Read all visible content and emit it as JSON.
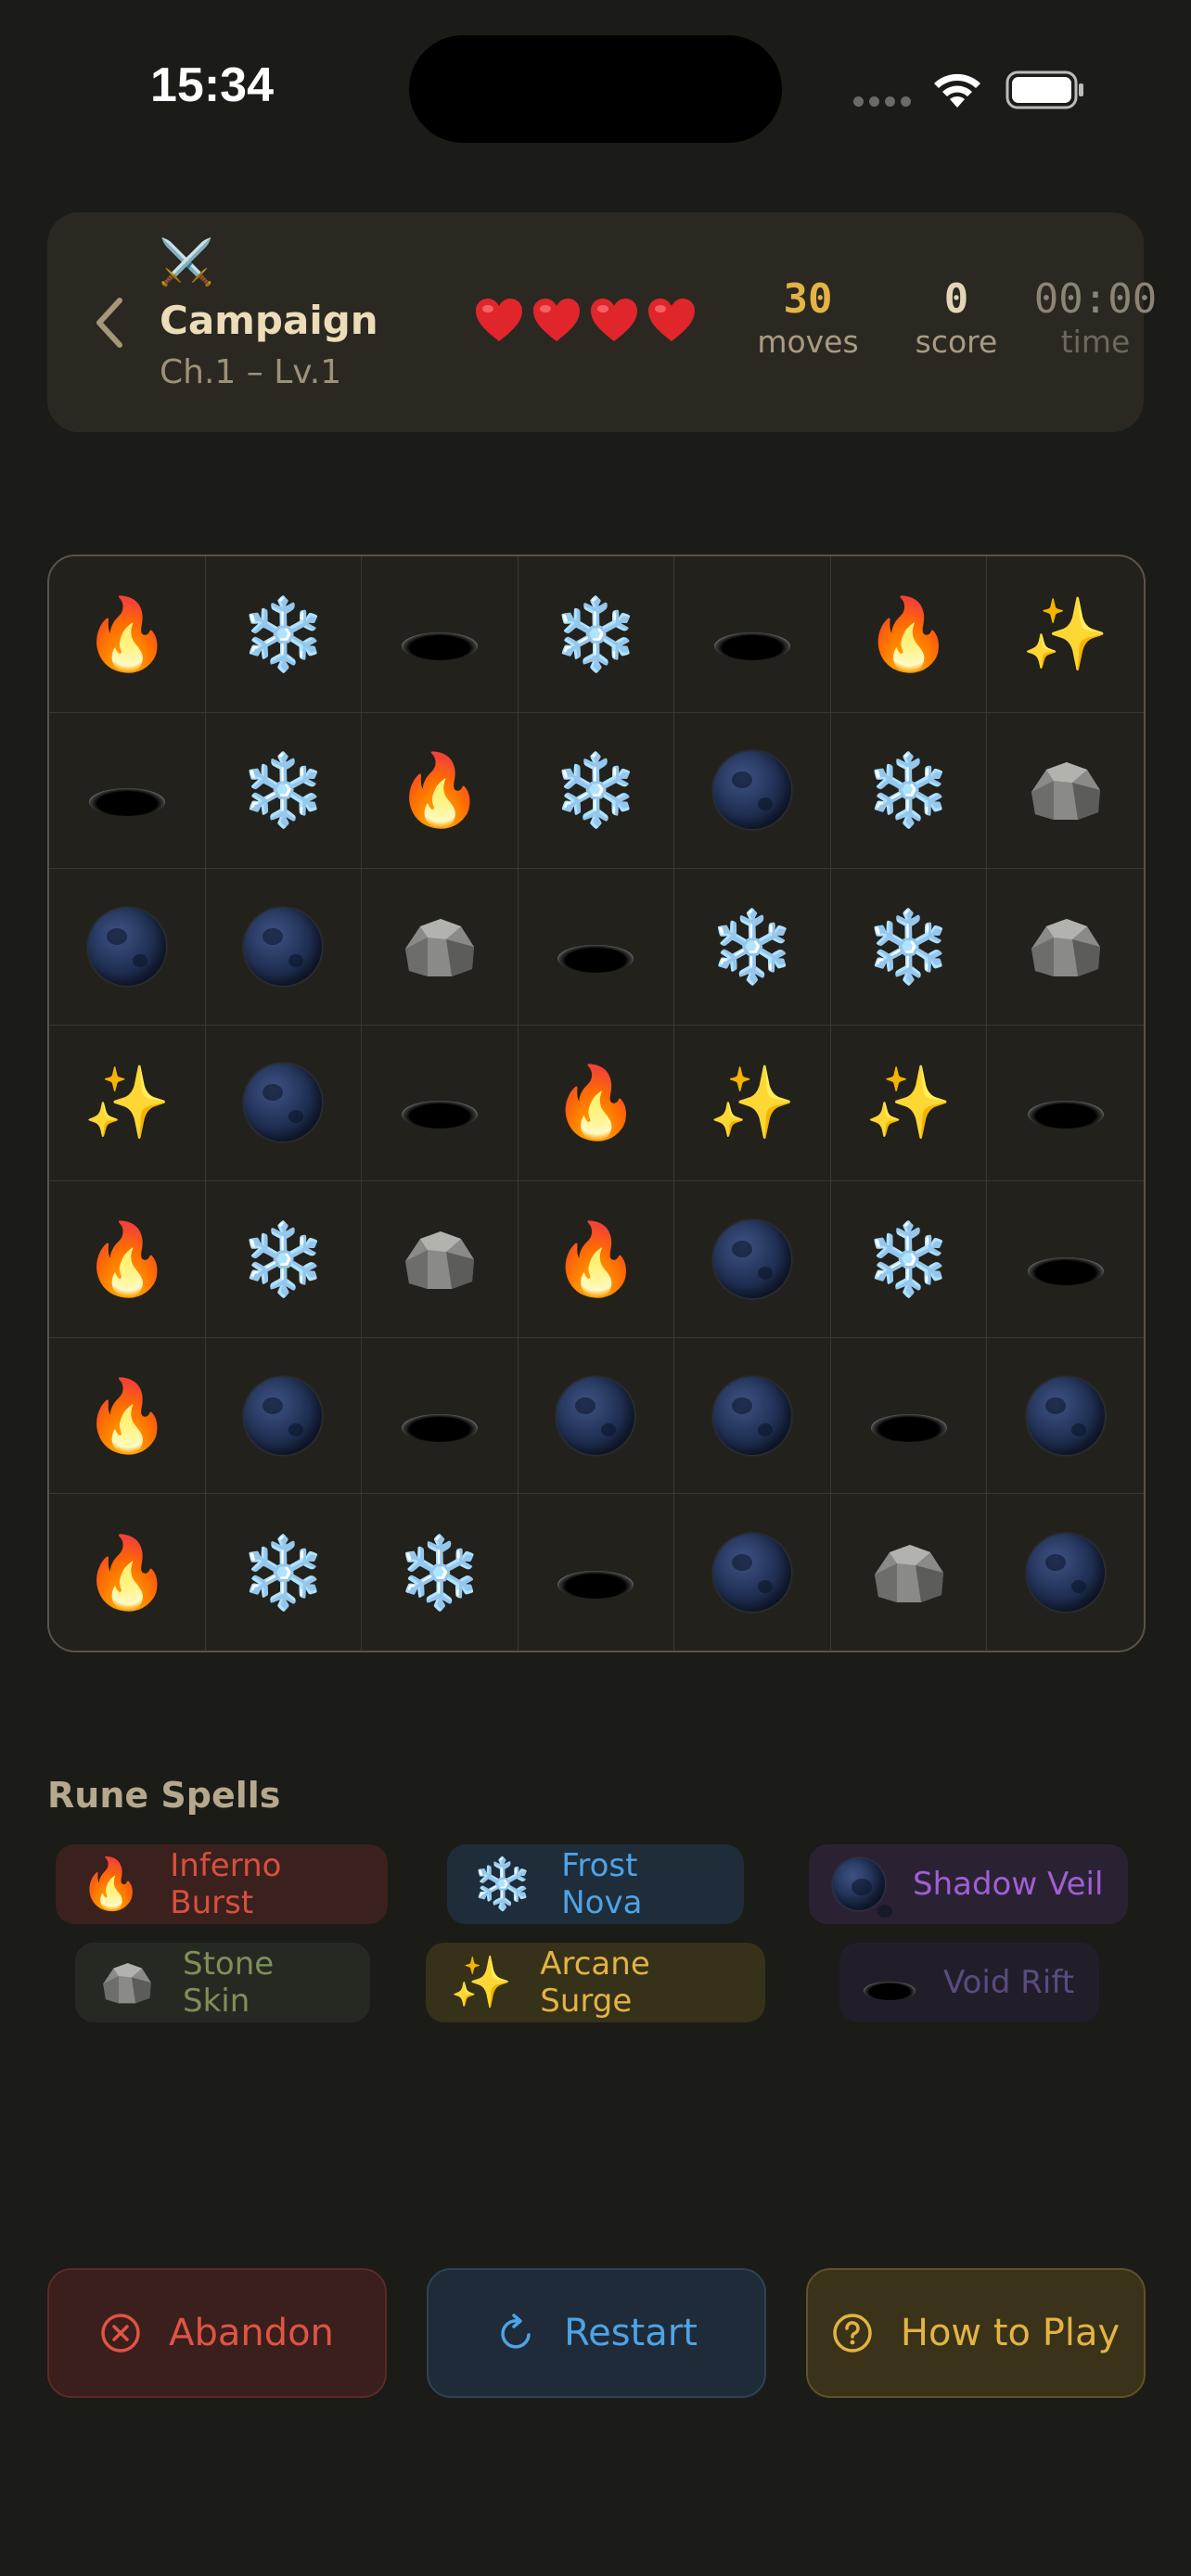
{
  "status_bar": {
    "time": "15:34"
  },
  "header": {
    "back_icon": "chevron-left-icon",
    "mode_icon": "⚔️",
    "title": "Campaign",
    "subtitle": "Ch.1 – Lv.1",
    "lives": 4,
    "moves_value": "30",
    "moves_label": "moves",
    "score_value": "0",
    "score_label": "score",
    "time_value": "00:00",
    "time_label": "time"
  },
  "board": {
    "rows": [
      [
        "fire",
        "frost",
        "void",
        "frost",
        "void",
        "fire",
        "arcane"
      ],
      [
        "void",
        "frost",
        "fire",
        "frost",
        "shadow",
        "frost",
        "stone"
      ],
      [
        "shadow",
        "shadow",
        "stone",
        "void",
        "frost",
        "frost",
        "stone"
      ],
      [
        "arcane",
        "shadow",
        "void",
        "fire",
        "arcane",
        "arcane",
        "void"
      ],
      [
        "fire",
        "frost",
        "stone",
        "fire",
        "shadow",
        "frost",
        "void"
      ],
      [
        "fire",
        "shadow",
        "void",
        "shadow",
        "shadow",
        "void",
        "shadow"
      ],
      [
        "fire",
        "frost",
        "frost",
        "void",
        "shadow",
        "stone",
        "shadow"
      ]
    ]
  },
  "spells": {
    "title": "Rune Spells",
    "items": [
      {
        "label": "Inferno Burst",
        "rune": "fire",
        "color": "#d94f3f"
      },
      {
        "label": "Frost Nova",
        "rune": "frost",
        "color": "#4ea3e6"
      },
      {
        "label": "Shadow Veil",
        "rune": "shadow",
        "color": "#a05fd6"
      },
      {
        "label": "Stone Skin",
        "rune": "stone",
        "color": "#7f8f5a"
      },
      {
        "label": "Arcane Surge",
        "rune": "arcane",
        "color": "#e3b443"
      },
      {
        "label": "Void Rift",
        "rune": "void",
        "color": "#5c4a82"
      }
    ]
  },
  "actions": {
    "abandon_label": "Abandon",
    "restart_label": "Restart",
    "howto_label": "How to Play"
  },
  "runes": {
    "fire": "🔥",
    "frost": "❄️",
    "arcane": "✨"
  }
}
